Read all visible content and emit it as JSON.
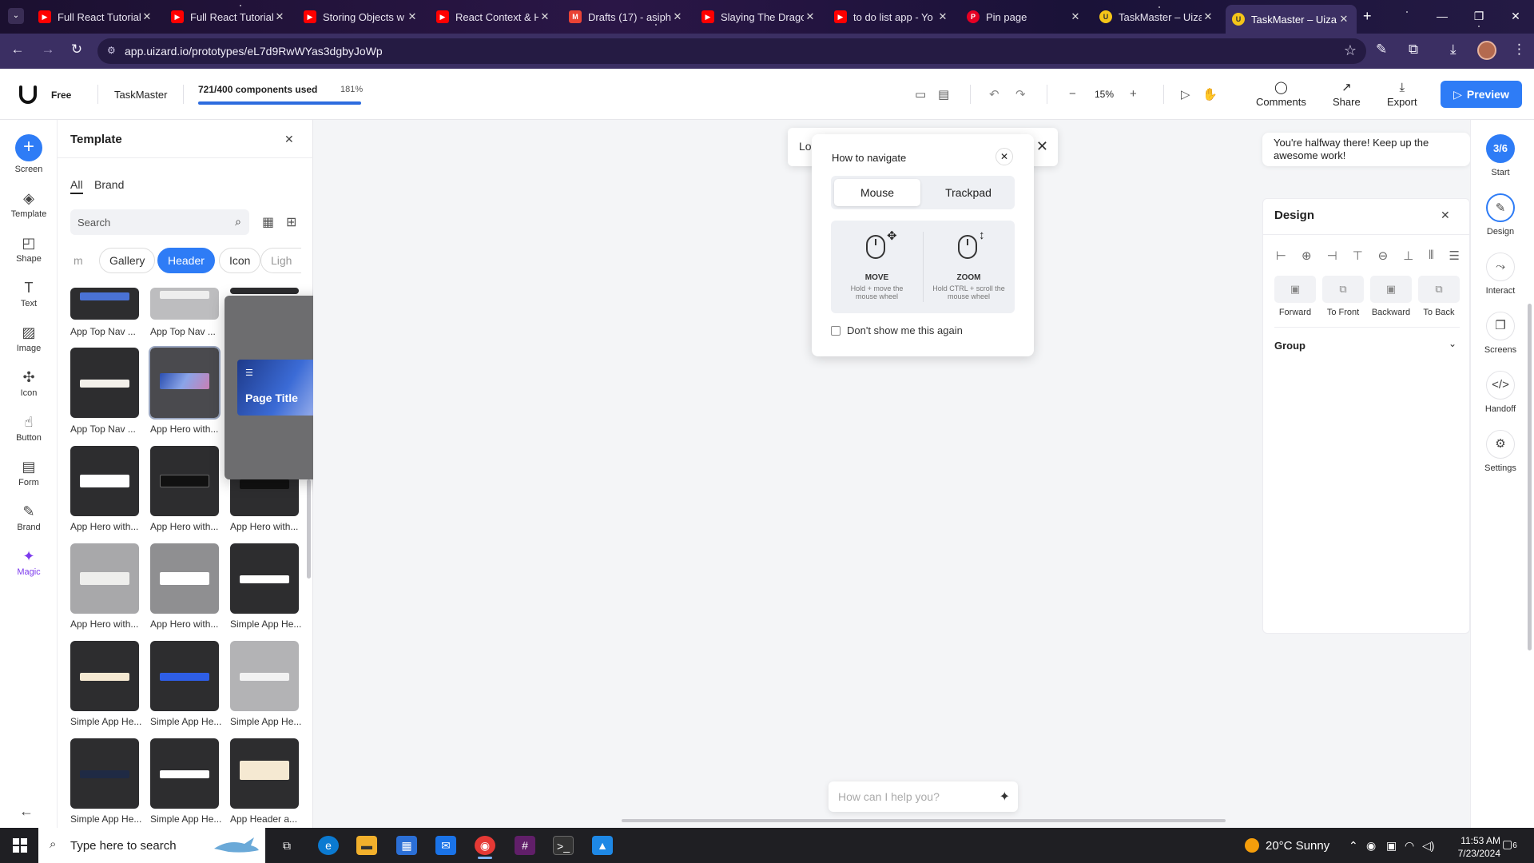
{
  "browser": {
    "tabs": [
      {
        "title": "Full React Tutorial",
        "icon": "youtube-icon",
        "color": "#ff0000"
      },
      {
        "title": "Full React Tutorial",
        "icon": "youtube-icon",
        "color": "#ff0000"
      },
      {
        "title": "Storing Objects w",
        "icon": "youtube-icon",
        "color": "#ff0000"
      },
      {
        "title": "React Context & H",
        "icon": "youtube-icon",
        "color": "#ff0000"
      },
      {
        "title": "Drafts (17) - asiph",
        "icon": "gmail-icon",
        "color": "#ea4335"
      },
      {
        "title": "Slaying The Drago",
        "icon": "youtube-icon",
        "color": "#ff0000"
      },
      {
        "title": "to do list app - Yo",
        "icon": "youtube-icon",
        "color": "#ff0000"
      },
      {
        "title": "Pin page",
        "icon": "pinterest-icon",
        "color": "#e60023"
      },
      {
        "title": "TaskMaster – Uiza",
        "icon": "uizard-icon",
        "color": "#f5c518"
      },
      {
        "title": "TaskMaster – Uiza",
        "icon": "uizard-icon",
        "color": "#f5c518"
      }
    ],
    "url": "app.uizard.io/prototypes/eL7d9RwWYas3dgbyJoWp"
  },
  "header": {
    "plan": "Free",
    "project": "TaskMaster",
    "usage_text": "721/400 components used",
    "usage_pct": "181%",
    "usage_fraction": 1.0,
    "zoom": "15%",
    "comments": "Comments",
    "share": "Share",
    "export": "Export",
    "preview": "Preview"
  },
  "rail": {
    "items": [
      "Screen",
      "Template",
      "Shape",
      "Text",
      "Image",
      "Icon",
      "Button",
      "Form",
      "Brand",
      "Magic"
    ]
  },
  "panel": {
    "title": "Template",
    "tabs": [
      "All",
      "Brand"
    ],
    "search_placeholder": "Search",
    "chips": [
      "m",
      "Gallery",
      "Header",
      "Icon",
      "Ligh"
    ],
    "active_chip": "Header",
    "items": [
      {
        "label": "App Top Nav ..."
      },
      {
        "label": "App Top Nav ..."
      },
      {
        "label": "App Top Nav ..."
      },
      {
        "label": "App Hero with..."
      },
      {
        "label": "App Hero with..."
      },
      {
        "label": "App Hero with..."
      },
      {
        "label": "App Hero with..."
      },
      {
        "label": "App Hero with..."
      },
      {
        "label": "App Hero with..."
      },
      {
        "label": "Simple App He..."
      },
      {
        "label": "Simple App He..."
      },
      {
        "label": "Simple App He..."
      },
      {
        "label": "Simple App He..."
      },
      {
        "label": "Simple App He..."
      },
      {
        "label": "Simple App He..."
      },
      {
        "label": "App Header a..."
      }
    ],
    "hover_preview_title": "Page Title"
  },
  "canvas": {
    "toast_text": "Lo",
    "nav_dialog": {
      "title": "How to navigate",
      "tab_mouse": "Mouse",
      "tab_trackpad": "Trackpad",
      "move_label": "MOVE",
      "move_sub": "Hold + move the mouse wheel",
      "zoom_label": "ZOOM",
      "zoom_sub": "Hold CTRL + scroll the mouse wheel",
      "checkbox": "Don't show me this again"
    },
    "chat_placeholder": "How can I help you?"
  },
  "right": {
    "halfway": "You're halfway there! Keep up the awesome work!",
    "progress": "3/6",
    "design_title": "Design",
    "order_buttons": [
      "Forward",
      "To Front",
      "Backward",
      "To Back"
    ],
    "group": "Group",
    "rail": [
      "Start",
      "Design",
      "Interact",
      "Screens",
      "Handoff",
      "Settings"
    ]
  },
  "taskbar": {
    "search": "Type here to search",
    "weather": "20°C  Sunny",
    "time": "11:53 AM",
    "date": "7/23/2024",
    "notifications": "6"
  }
}
